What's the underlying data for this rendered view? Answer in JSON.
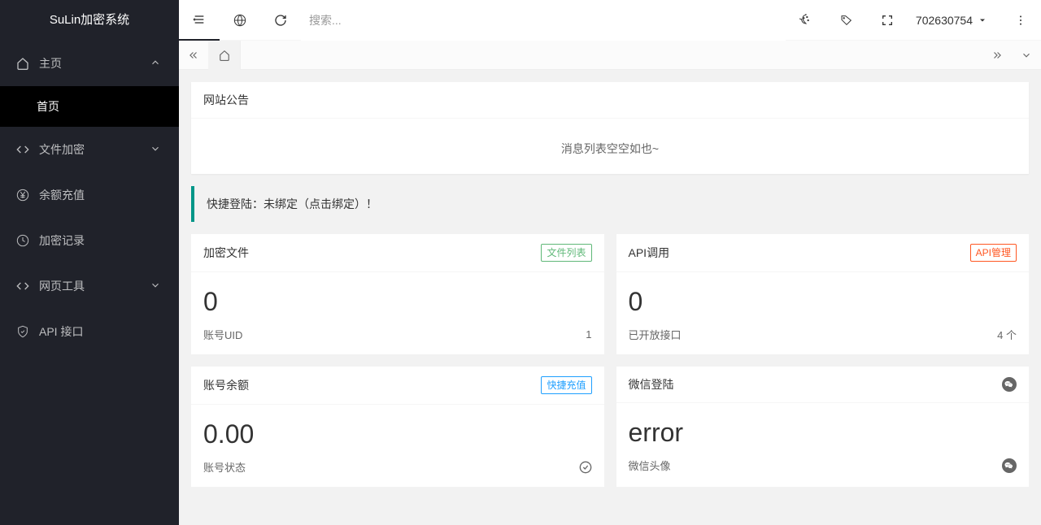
{
  "logo": "SuLin加密系统",
  "sidebar": {
    "items": [
      {
        "label": "主页",
        "icon": "home"
      },
      {
        "label": "文件加密",
        "icon": "code"
      },
      {
        "label": "余额充值",
        "icon": "yen"
      },
      {
        "label": "加密记录",
        "icon": "clock"
      },
      {
        "label": "网页工具",
        "icon": "code"
      },
      {
        "label": "API 接口",
        "icon": "shield"
      }
    ],
    "subitem": "首页"
  },
  "header": {
    "search_placeholder": "搜索...",
    "user_id": "702630754"
  },
  "notice": {
    "title": "网站公告",
    "empty": "消息列表空空如也~"
  },
  "alert": "快捷登陆：未绑定（点击绑定）！",
  "cards": [
    {
      "title": "加密文件",
      "badge": "文件列表",
      "badge_style": "green",
      "value": "0",
      "foot_label": "账号UID",
      "foot_value": "1"
    },
    {
      "title": "API调用",
      "badge": "API管理",
      "badge_style": "red",
      "value": "0",
      "foot_label": "已开放接口",
      "foot_value": "4 个"
    },
    {
      "title": "账号余额",
      "badge": "快捷充值",
      "badge_style": "blue",
      "value": "0.00",
      "foot_label": "账号状态",
      "foot_value": ""
    },
    {
      "title": "微信登陆",
      "badge": "",
      "badge_style": "",
      "value": "error",
      "foot_label": "微信头像",
      "foot_value": ""
    }
  ]
}
